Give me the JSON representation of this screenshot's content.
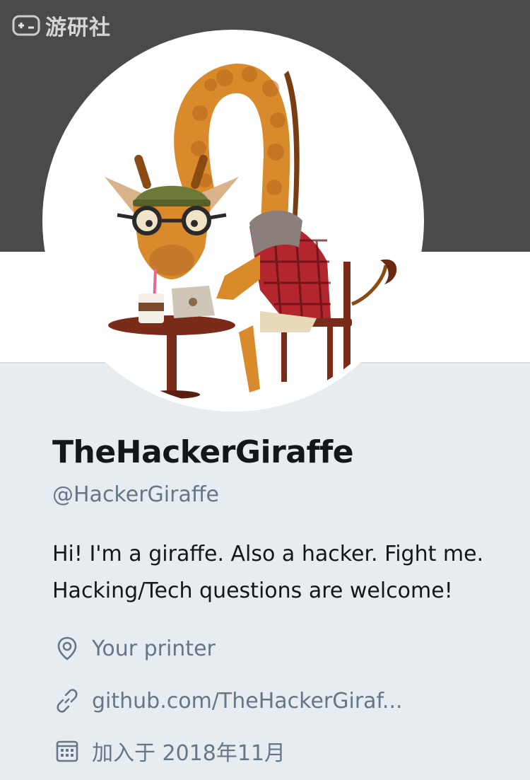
{
  "watermark": {
    "text": "游研社",
    "icon": "gamepad-icon"
  },
  "profile": {
    "display_name": "TheHackerGiraffe",
    "handle": "@HackerGiraffe",
    "bio_lines": [
      "Hi! I'm a giraffe. Also a hacker. Fight me.",
      "Hacking/Tech questions are welcome!"
    ],
    "location": {
      "icon": "location-pin-icon",
      "text": "Your printer"
    },
    "website": {
      "icon": "link-icon",
      "text": "github.com/TheHackerGiraf..."
    },
    "joined": {
      "icon": "calendar-icon",
      "text": "加入于 2018年11月"
    }
  },
  "colors": {
    "banner": "#4a4a4b",
    "page_bg": "#e6ecf0",
    "secondary_text": "#657786",
    "primary_text": "#14171a"
  }
}
